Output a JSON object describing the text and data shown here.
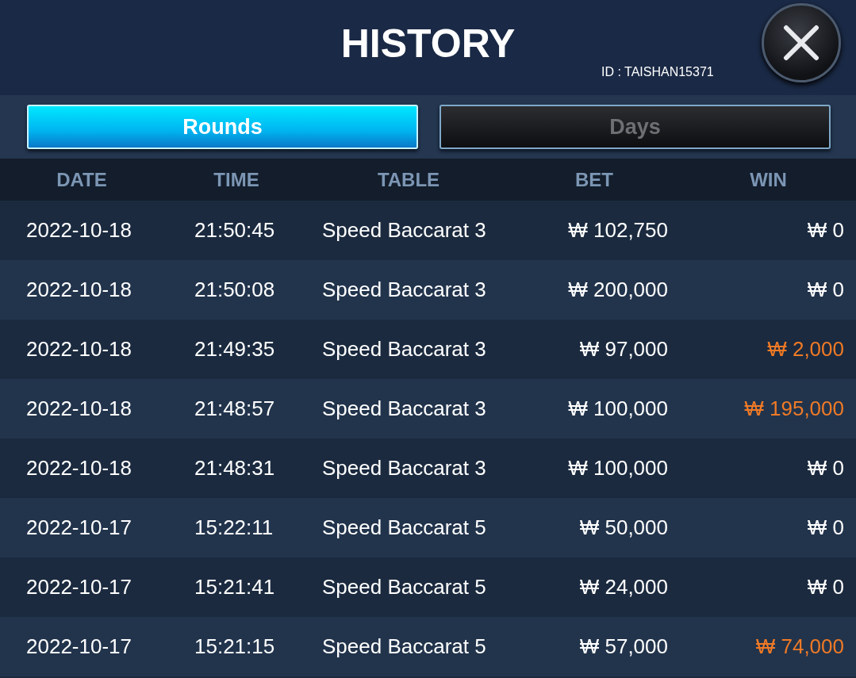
{
  "header": {
    "title": "HISTORY",
    "user_id": "ID : TAISHAN15371"
  },
  "tabs": [
    {
      "label": "Rounds",
      "selected": true
    },
    {
      "label": "Days",
      "selected": false
    }
  ],
  "table": {
    "columns": [
      "DATE",
      "TIME",
      "TABLE",
      "BET",
      "WIN"
    ],
    "rows": [
      {
        "date": "2022-10-18",
        "time": "21:50:45",
        "table": "Speed Baccarat 3",
        "bet": "₩ 102,750",
        "win": "₩ 0",
        "won": false
      },
      {
        "date": "2022-10-18",
        "time": "21:50:08",
        "table": "Speed Baccarat 3",
        "bet": "₩ 200,000",
        "win": "₩ 0",
        "won": false
      },
      {
        "date": "2022-10-18",
        "time": "21:49:35",
        "table": "Speed Baccarat 3",
        "bet": "₩ 97,000",
        "win": "₩ 2,000",
        "won": true
      },
      {
        "date": "2022-10-18",
        "time": "21:48:57",
        "table": "Speed Baccarat 3",
        "bet": "₩ 100,000",
        "win": "₩ 195,000",
        "won": true
      },
      {
        "date": "2022-10-18",
        "time": "21:48:31",
        "table": "Speed Baccarat 3",
        "bet": "₩ 100,000",
        "win": "₩ 0",
        "won": false
      },
      {
        "date": "2022-10-17",
        "time": "15:22:11",
        "table": "Speed Baccarat 5",
        "bet": "₩ 50,000",
        "win": "₩ 0",
        "won": false
      },
      {
        "date": "2022-10-17",
        "time": "15:21:41",
        "table": "Speed Baccarat 5",
        "bet": "₩ 24,000",
        "win": "₩ 0",
        "won": false
      },
      {
        "date": "2022-10-17",
        "time": "15:21:15",
        "table": "Speed Baccarat 5",
        "bet": "₩ 57,000",
        "win": "₩ 74,000",
        "won": true
      }
    ]
  }
}
